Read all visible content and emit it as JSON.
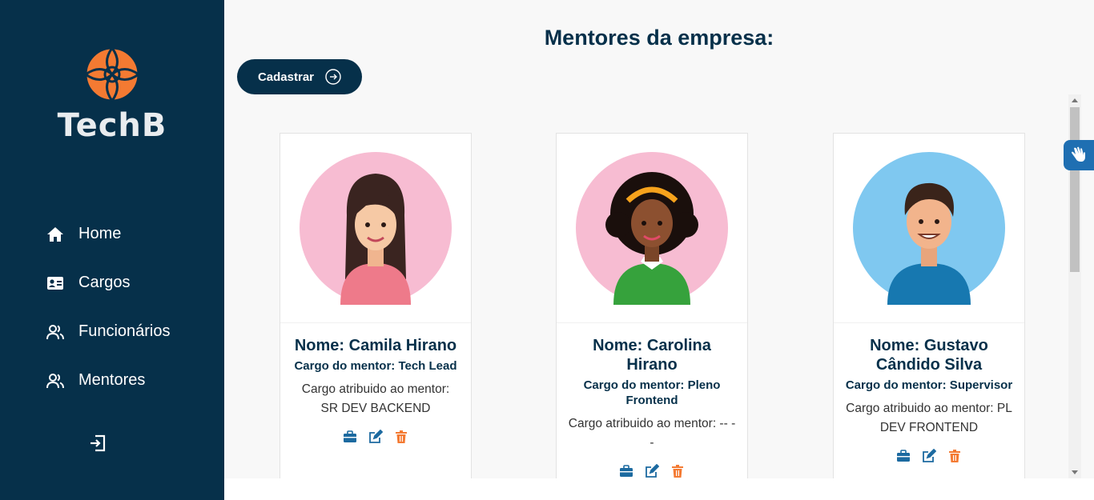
{
  "app": {
    "logo_text": "TechB",
    "colors": {
      "sidebar": "#06304a",
      "accent": "#f47a32",
      "action_blue": "#1c6aa0",
      "delete": "#f47a32"
    }
  },
  "nav": {
    "items": [
      {
        "label": "Home",
        "icon": "home-icon"
      },
      {
        "label": "Cargos",
        "icon": "id-card-icon"
      },
      {
        "label": "Funcionários",
        "icon": "users-icon"
      },
      {
        "label": "Mentores",
        "icon": "users-icon"
      }
    ],
    "logout_icon": "logout-icon"
  },
  "page": {
    "title": "Mentores da empresa:",
    "register_button": "Cadastrar"
  },
  "mentors": [
    {
      "name": "Nome: Camila Hirano",
      "role": "Cargo do mentor: Tech Lead",
      "assigned": "Cargo atribuido ao mentor: SR DEV BACKEND",
      "avatar_bg": "#f7bcd2"
    },
    {
      "name": "Nome: Carolina Hirano",
      "role": "Cargo do mentor: Pleno Frontend",
      "assigned": "Cargo atribuido ao mentor: -- --",
      "avatar_bg": "#f7bcd2"
    },
    {
      "name": "Nome: Gustavo Cândido Silva",
      "role": "Cargo do mentor: Supervisor",
      "assigned": "Cargo atribuido ao mentor: PL DEV FRONTEND",
      "avatar_bg": "#7fc8f0"
    }
  ],
  "card_actions": [
    "briefcase-icon",
    "edit-icon",
    "trash-icon"
  ]
}
